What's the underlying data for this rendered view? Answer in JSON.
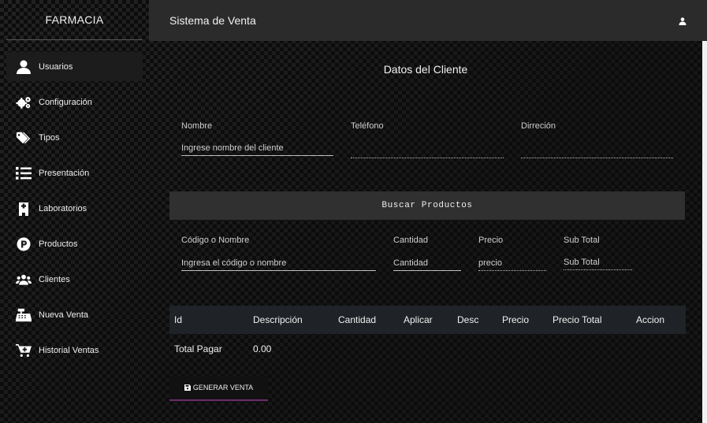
{
  "sidebar": {
    "brand": "FARMACIA",
    "items": [
      {
        "label": "Usuarios",
        "icon": "user-icon",
        "active": true
      },
      {
        "label": "Configuración",
        "icon": "gears-icon"
      },
      {
        "label": "Tipos",
        "icon": "tags-icon"
      },
      {
        "label": "Presentación",
        "icon": "list-icon"
      },
      {
        "label": "Laboratorios",
        "icon": "building-icon"
      },
      {
        "label": "Productos",
        "icon": "product-p-icon"
      },
      {
        "label": "Clientes",
        "icon": "users-icon"
      },
      {
        "label": "Nueva Venta",
        "icon": "cash-register-icon"
      },
      {
        "label": "Historial Ventas",
        "icon": "cart-plus-icon"
      }
    ]
  },
  "header": {
    "title": "Sistema de Venta",
    "user_icon": "user-icon"
  },
  "client": {
    "title": "Datos del Cliente",
    "nombre_label": "Nombre",
    "nombre_placeholder": "Ingrese nombre del cliente",
    "telefono_label": "Teléfono",
    "telefono_value": "",
    "direccion_label": "Dirreción",
    "direccion_value": ""
  },
  "search": {
    "title": "Buscar Productos",
    "codigo_label": "Código o Nombre",
    "codigo_placeholder": "Ingresa el código o nombre",
    "cantidad_label": "Cantidad",
    "cantidad_placeholder": "Cantidad",
    "precio_label": "Precio",
    "precio_placeholder": "precio",
    "subtotal_label": "Sub Total",
    "subtotal_placeholder": "Sub Total"
  },
  "table": {
    "columns": [
      "Id",
      "Descripción",
      "Cantidad",
      "Aplicar",
      "Desc",
      "Precio",
      "Precio Total",
      "Accion"
    ],
    "total_label": "Total Pagar",
    "total_value": "0.00"
  },
  "actions": {
    "generate_label": "GENERAR VENTA",
    "generate_icon": "save-icon"
  },
  "colors": {
    "topbar": "#2b2b2b",
    "table_header": "#1f2327",
    "search_bar": "#303030",
    "button_accent": "#6b2d6b"
  }
}
